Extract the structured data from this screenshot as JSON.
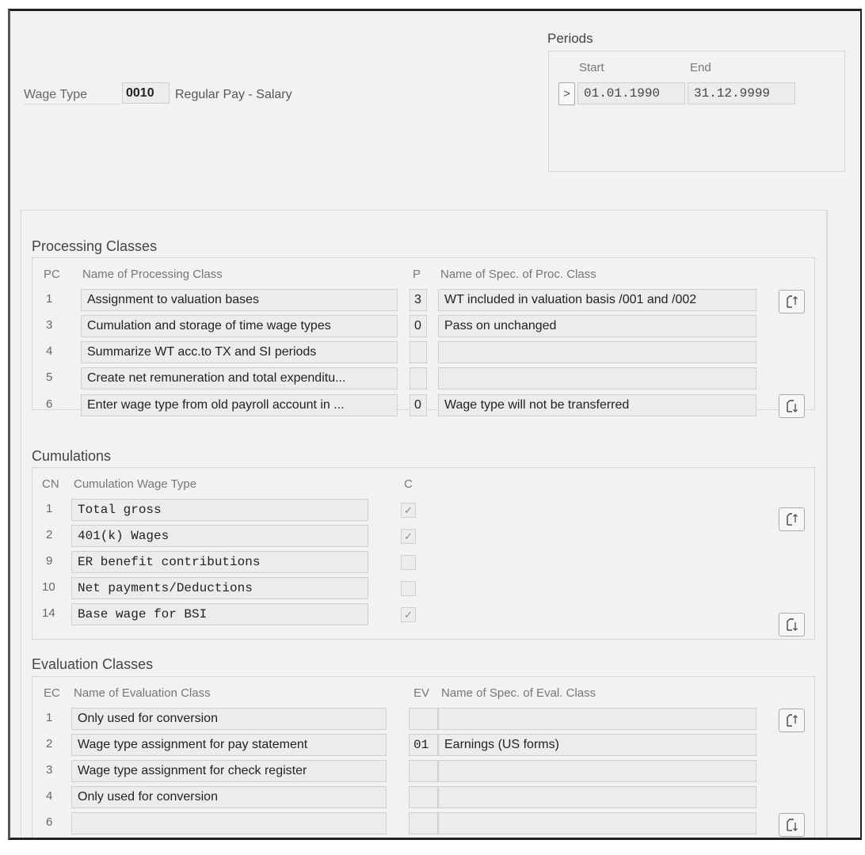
{
  "header": {
    "wage_type_label": "Wage Type",
    "wage_type_value": "0010",
    "wage_type_text": "Regular Pay - Salary"
  },
  "periods": {
    "title": "Periods",
    "start_label": "Start",
    "end_label": "End",
    "nav_button": ">",
    "start_value": "01.01.1990",
    "end_value": "31.12.9999"
  },
  "processing_classes": {
    "title": "Processing Classes",
    "col_pc": "PC",
    "col_name": "Name of Processing Class",
    "col_p": "P",
    "col_spec": "Name of Spec. of Proc. Class",
    "rows": [
      {
        "pc": "1",
        "name": "Assignment to valuation bases",
        "p": "3",
        "spec": "WT included in valuation basis /001 and /002"
      },
      {
        "pc": "3",
        "name": "Cumulation and storage of time wage types",
        "p": "0",
        "spec": "Pass on unchanged"
      },
      {
        "pc": "4",
        "name": "Summarize WT acc.to TX and SI periods",
        "p": "",
        "spec": ""
      },
      {
        "pc": "5",
        "name": "Create net remuneration and total expenditu...",
        "p": "",
        "spec": ""
      },
      {
        "pc": "6",
        "name": "Enter wage type from old payroll account in ...",
        "p": "0",
        "spec": "Wage type will not be transferred"
      }
    ]
  },
  "cumulations": {
    "title": "Cumulations",
    "col_cn": "CN",
    "col_name": "Cumulation Wage Type",
    "col_c": "C",
    "rows": [
      {
        "cn": "1",
        "name": "Total gross",
        "checked": true
      },
      {
        "cn": "2",
        "name": "401(k) Wages",
        "checked": true
      },
      {
        "cn": "9",
        "name": "ER benefit contributions",
        "checked": false
      },
      {
        "cn": "10",
        "name": "Net payments/Deductions",
        "checked": false
      },
      {
        "cn": "14",
        "name": "Base wage for BSI",
        "checked": true
      }
    ]
  },
  "evaluation_classes": {
    "title": "Evaluation Classes",
    "col_ec": "EC",
    "col_name": "Name of Evaluation Class",
    "col_ev": "EV",
    "col_spec": "Name of Spec. of Eval. Class",
    "rows": [
      {
        "ec": "1",
        "name": "Only used for conversion",
        "ev": "",
        "spec": ""
      },
      {
        "ec": "2",
        "name": "Wage type assignment for pay statement",
        "ev": "01",
        "spec": "Earnings (US forms)"
      },
      {
        "ec": "3",
        "name": "Wage type assignment for check register",
        "ev": "",
        "spec": ""
      },
      {
        "ec": "4",
        "name": "Only used for conversion",
        "ev": "",
        "spec": ""
      },
      {
        "ec": "6",
        "name": "",
        "ev": "",
        "spec": ""
      }
    ]
  },
  "icons": {
    "scroll_up": "page-up-icon",
    "scroll_down": "page-down-icon",
    "check": "✓"
  }
}
